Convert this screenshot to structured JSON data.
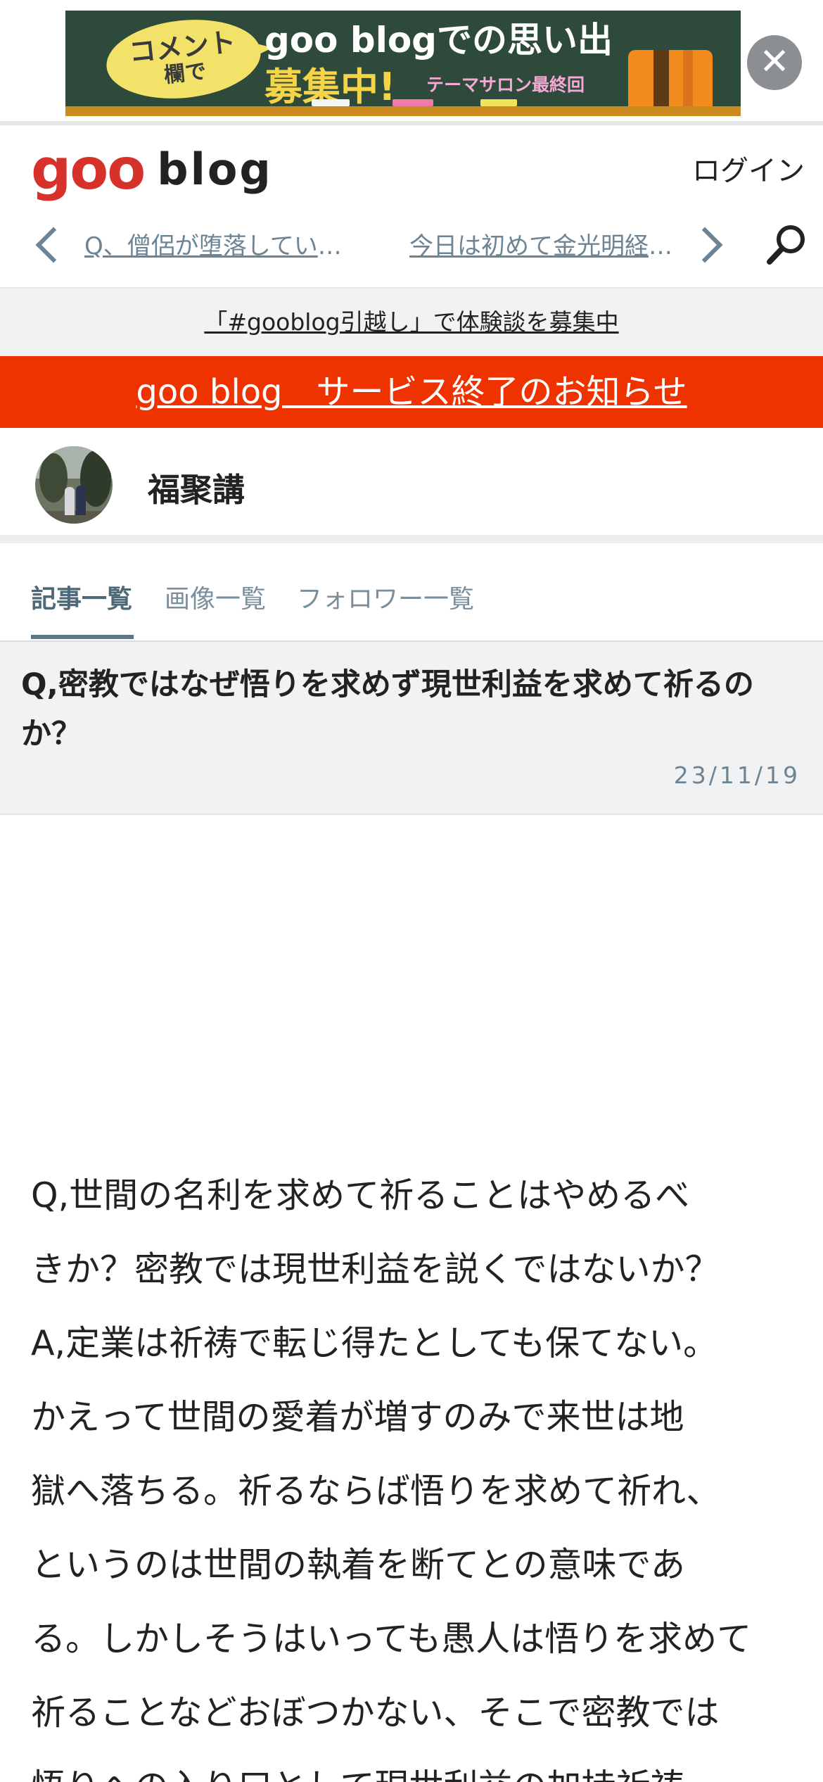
{
  "ad": {
    "bubble_line1": "コメント",
    "bubble_line2": "欄で",
    "title": "goo blogでの思い出",
    "subtitle": "募集中!",
    "tag": "テーマサロン最終回",
    "close_symbol": "✕"
  },
  "header": {
    "logo_goo": "goo",
    "logo_blog": "blog",
    "login_label": "ログイン",
    "prev_post": "Q、僧侶が堕落しているのはなぜか？",
    "next_post": "今日は初めて金光明経を読みました"
  },
  "notices": {
    "gray": "「#gooblog引越し」で体験談を募集中",
    "red": "goo blog　サービス終了のお知らせ"
  },
  "profile": {
    "name": "福聚講"
  },
  "tabs": [
    {
      "label": "記事一覧",
      "active": true
    },
    {
      "label": "画像一覧",
      "active": false
    },
    {
      "label": "フォロワー一覧",
      "active": false
    }
  ],
  "article": {
    "title": "Q,密教ではなぜ悟りを求めず現世利益を求めて祈るのか？",
    "date": "23/11/19",
    "lines": [
      "Q,世間の名利を求めて祈ることはやめるべ",
      "きか？密教では現世利益を説くではないか？",
      "A,定業は祈祷で転じ得たとしても保てない。",
      "かえって世間の愛着が増すのみで来世は地",
      "獄へ落ちる。祈るならば悟りを求めて祈れ、",
      "というのは世間の執着を断てとの意味であ",
      "る。しかしそうはいっても愚人は悟りを求めて",
      "祈ることなどおぼつかない、そこで密教では",
      "悟りへの入り口として現世利益の加持祈祷"
    ]
  },
  "colors": {
    "brand_red": "#d7312b",
    "notice_red": "#ee3300",
    "link_blue_gray": "#6d8495"
  }
}
